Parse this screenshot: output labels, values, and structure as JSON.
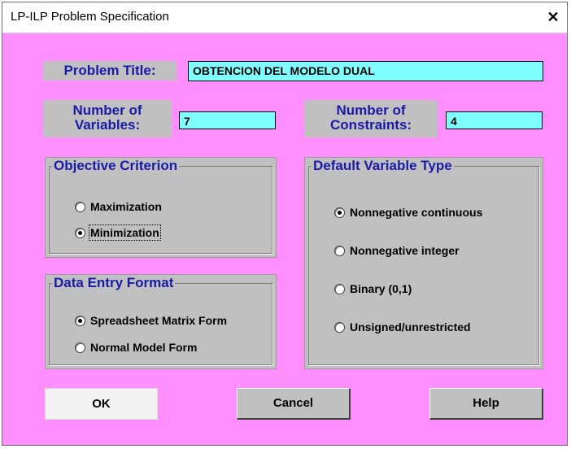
{
  "window": {
    "title": "LP-ILP Problem Specification",
    "close_glyph": "✕"
  },
  "problem_title": {
    "label": "Problem Title:",
    "value": "OBTENCION DEL MODELO DUAL"
  },
  "variables": {
    "label_line1": "Number of",
    "label_line2": "Variables:",
    "value": "7"
  },
  "constraints": {
    "label_line1": "Number of",
    "label_line2": "Constraints:",
    "value": "4"
  },
  "objective": {
    "legend": "Objective Criterion",
    "options": [
      "Maximization",
      "Minimization"
    ],
    "selected": "Minimization"
  },
  "data_entry": {
    "legend": "Data Entry Format",
    "options": [
      "Spreadsheet Matrix Form",
      "Normal Model Form"
    ],
    "selected": "Spreadsheet Matrix Form"
  },
  "variable_type": {
    "legend": "Default Variable Type",
    "options": [
      "Nonnegative continuous",
      "Nonnegative integer",
      "Binary (0,1)",
      "Unsigned/unrestricted"
    ],
    "selected": "Nonnegative continuous"
  },
  "buttons": {
    "ok": "OK",
    "cancel": "Cancel",
    "help": "Help"
  },
  "colors": {
    "background": "#ff8fff",
    "field": "#80ffff",
    "label_text": "#1a1aa8",
    "panel": "#c0c0c0"
  }
}
